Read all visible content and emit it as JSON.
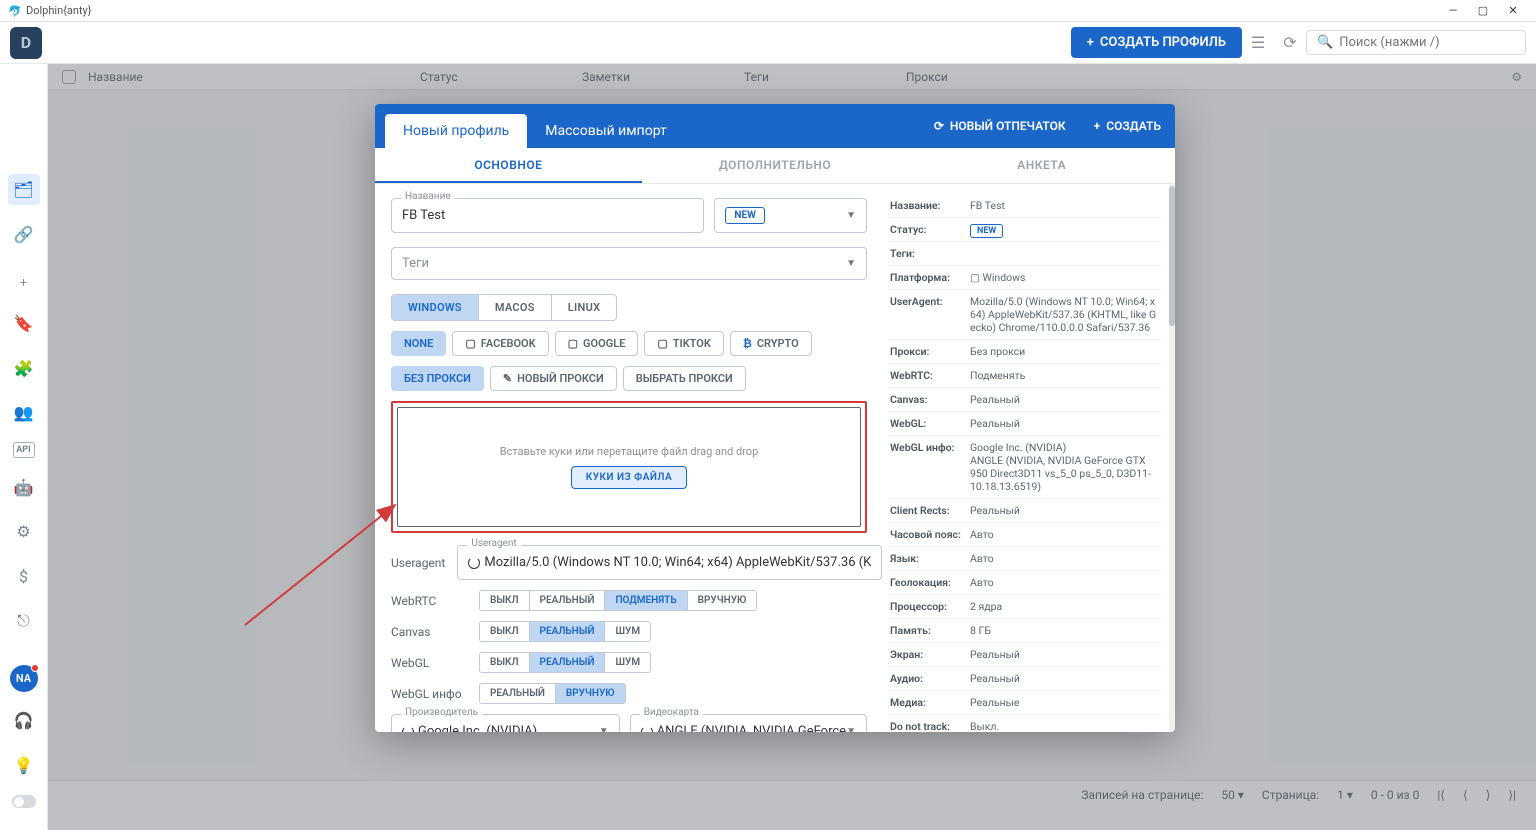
{
  "window": {
    "title": "Dolphin{anty}"
  },
  "topbar": {
    "create_btn": "СОЗДАТЬ ПРОФИЛЬ",
    "search_placeholder": "Поиск (нажми /)"
  },
  "table_headers": {
    "name": "Название",
    "status": "Статус",
    "notes": "Заметки",
    "tags": "Теги",
    "proxy": "Прокси"
  },
  "pagination": {
    "per_page_label": "Записей на странице:",
    "per_page_value": "50",
    "page_label": "Страница:",
    "page_value": "1",
    "range": "0 - 0 из 0"
  },
  "avatar_initials": "NA",
  "modal": {
    "tab_new": "Новый профиль",
    "tab_mass": "Массовый импорт",
    "new_fingerprint": "НОВЫЙ ОТПЕЧАТОК",
    "create": "СОЗДАТЬ",
    "subtab_main": "ОСНОВНОЕ",
    "subtab_additional": "ДОПОЛНИТЕЛЬНО",
    "subtab_questionnaire": "АНКЕТА",
    "form": {
      "name_label": "Название",
      "name_value": "FB Test",
      "status_chip": "NEW",
      "tags_placeholder": "Теги",
      "os_windows": "WINDOWS",
      "os_macos": "MACOS",
      "os_linux": "LINUX",
      "site_none": "NONE",
      "site_facebook": "FACEBOOK",
      "site_google": "GOOGLE",
      "site_tiktok": "TIKTOK",
      "site_crypto": "CRYPTO",
      "proxy_none": "БЕЗ ПРОКСИ",
      "proxy_new": "НОВЫЙ ПРОКСИ",
      "proxy_select": "ВЫБРАТЬ ПРОКСИ",
      "cookie_msg": "Вставьте куки или перетащите файл drag and drop",
      "cookie_btn": "КУКИ ИЗ ФАЙЛА",
      "useragent_label": "Useragent",
      "useragent_fieldlabel": "Useragent",
      "useragent_value": "Mozilla/5.0 (Windows NT 10.0; Win64; x64) AppleWebKit/537.36 (K",
      "webrtc_label": "WebRTC",
      "canvas_label": "Canvas",
      "webgl_label": "WebGL",
      "webglinfo_label": "WebGL инфо",
      "opt_off": "ВЫКЛ",
      "opt_real": "РЕАЛЬНЫЙ",
      "opt_substitute": "ПОДМЕНЯТЬ",
      "opt_manual": "ВРУЧНУЮ",
      "opt_noise": "ШУМ",
      "vendor_label": "Производитель",
      "vendor_value": "Google Inc. (NVIDIA)",
      "videocard_label": "Видеокарта",
      "videocard_value": "ANGLE (NVIDIA, NVIDIA GeForce"
    },
    "summary": {
      "name_l": "Название:",
      "name_v": "FB Test",
      "status_l": "Статус:",
      "status_v": "NEW",
      "tags_l": "Теги:",
      "tags_v": "",
      "platform_l": "Платформа:",
      "platform_v": "Windows",
      "useragent_l": "UserAgent:",
      "useragent_v": "Mozilla/5.0 (Windows NT 10.0; Win64; x64) AppleWebKit/537.36 (KHTML, like Gecko) Chrome/110.0.0.0 Safari/537.36",
      "proxy_l": "Прокси:",
      "proxy_v": "Без прокси",
      "webrtc_l": "WebRTC:",
      "webrtc_v": "Подменять",
      "canvas_l": "Canvas:",
      "canvas_v": "Реальный",
      "webgl_l": "WebGL:",
      "webgl_v": "Реальный",
      "webglinfo_l": "WebGL инфо:",
      "webglinfo_v": "Google Inc. (NVIDIA)\nANGLE (NVIDIA, NVIDIA GeForce GTX 950 Direct3D11 vs_5_0 ps_5_0, D3D11-10.18.13.6519)",
      "clientrects_l": "Client Rects:",
      "clientrects_v": "Реальный",
      "timezone_l": "Часовой пояс:",
      "timezone_v": "Авто",
      "lang_l": "Язык:",
      "lang_v": "Авто",
      "geo_l": "Геолокация:",
      "geo_v": "Авто",
      "cpu_l": "Процессор:",
      "cpu_v": "2 ядра",
      "memory_l": "Память:",
      "memory_v": "8 ГБ",
      "screen_l": "Экран:",
      "screen_v": "Реальный",
      "audio_l": "Аудио:",
      "audio_v": "Реальный",
      "media_l": "Медиа:",
      "media_v": "Реальные",
      "dnt_l": "Do not track:",
      "dnt_v": "Выкл."
    }
  }
}
